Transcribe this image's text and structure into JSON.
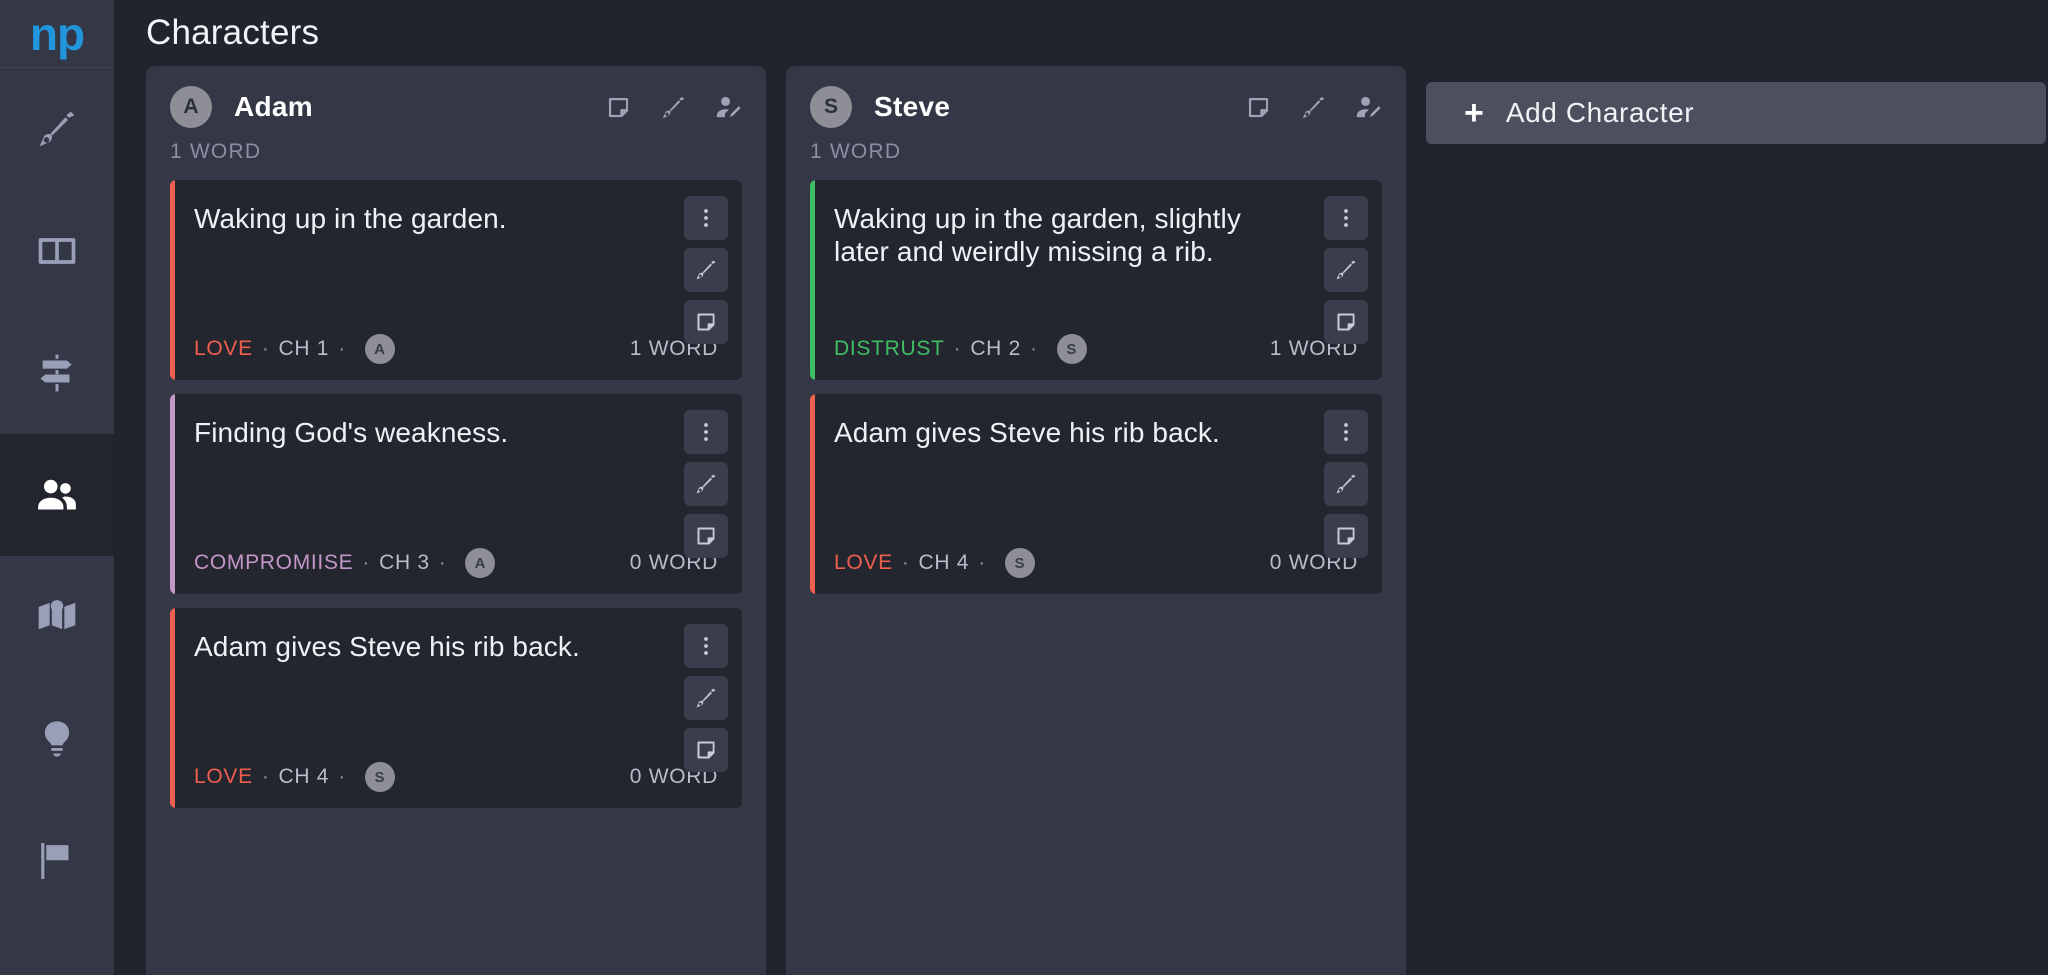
{
  "app": {
    "logo": "np"
  },
  "sidebar": {
    "items": [
      {
        "name": "write",
        "icon": "pen-nib-icon",
        "active": false
      },
      {
        "name": "outline",
        "icon": "columns-icon",
        "active": false
      },
      {
        "name": "plot",
        "icon": "signpost-icon",
        "active": false
      },
      {
        "name": "characters",
        "icon": "people-icon",
        "active": true
      },
      {
        "name": "world",
        "icon": "map-icon",
        "active": false
      },
      {
        "name": "ideas",
        "icon": "lightbulb-icon",
        "active": false
      },
      {
        "name": "goals",
        "icon": "checkered-flag-icon",
        "active": false
      }
    ]
  },
  "header": {
    "title": "Characters"
  },
  "colors": {
    "love": "#ef5f4e",
    "distrust": "#3fbf63",
    "compromiise": "#c597c8",
    "accent_blue": "#2196dd",
    "column_bg": "#343746",
    "card_bg": "#23252f",
    "page_bg": "#21232d"
  },
  "columns": [
    {
      "initial": "A",
      "name": "Adam",
      "word_count": "1 WORD",
      "actions": [
        "note-icon",
        "pen-nib-icon",
        "edit-person-icon"
      ],
      "cards": [
        {
          "title": "Waking up in the garden.",
          "accent": "#ef5f4e",
          "tag": "LOVE",
          "tag_color": "#ef5f4e",
          "chapter": "CH 1",
          "chip": "A",
          "words": "1 WORD",
          "tools": [
            "kebab-menu-icon",
            "pen-nib-icon",
            "note-icon"
          ]
        },
        {
          "title": "Finding God's weakness.",
          "accent": "#c597c8",
          "tag": "COMPROMIISE",
          "tag_color": "#c597c8",
          "chapter": "CH 3",
          "chip": "A",
          "words": "0 WORD",
          "tools": [
            "kebab-menu-icon",
            "pen-nib-icon",
            "note-icon"
          ]
        },
        {
          "title": "Adam gives Steve his rib back.",
          "accent": "#ef5f4e",
          "tag": "LOVE",
          "tag_color": "#ef5f4e",
          "chapter": "CH 4",
          "chip": "S",
          "words": "0 WORD",
          "tools": [
            "kebab-menu-icon",
            "pen-nib-icon",
            "note-icon"
          ]
        }
      ]
    },
    {
      "initial": "S",
      "name": "Steve",
      "word_count": "1 WORD",
      "actions": [
        "note-icon",
        "pen-nib-icon",
        "edit-person-icon"
      ],
      "cards": [
        {
          "title": "Waking up in the garden, slightly later and weirdly missing a rib.",
          "accent": "#3fbf63",
          "tag": "DISTRUST",
          "tag_color": "#3fbf63",
          "chapter": "CH 2",
          "chip": "S",
          "words": "1 WORD",
          "tools": [
            "kebab-menu-icon",
            "pen-nib-icon",
            "note-icon"
          ]
        },
        {
          "title": "Adam gives Steve his rib back.",
          "accent": "#ef5f4e",
          "tag": "LOVE",
          "tag_color": "#ef5f4e",
          "chapter": "CH 4",
          "chip": "S",
          "words": "0 WORD",
          "tools": [
            "kebab-menu-icon",
            "pen-nib-icon",
            "note-icon"
          ]
        }
      ]
    }
  ],
  "add_character": {
    "plus": "+",
    "label": "Add Character"
  }
}
